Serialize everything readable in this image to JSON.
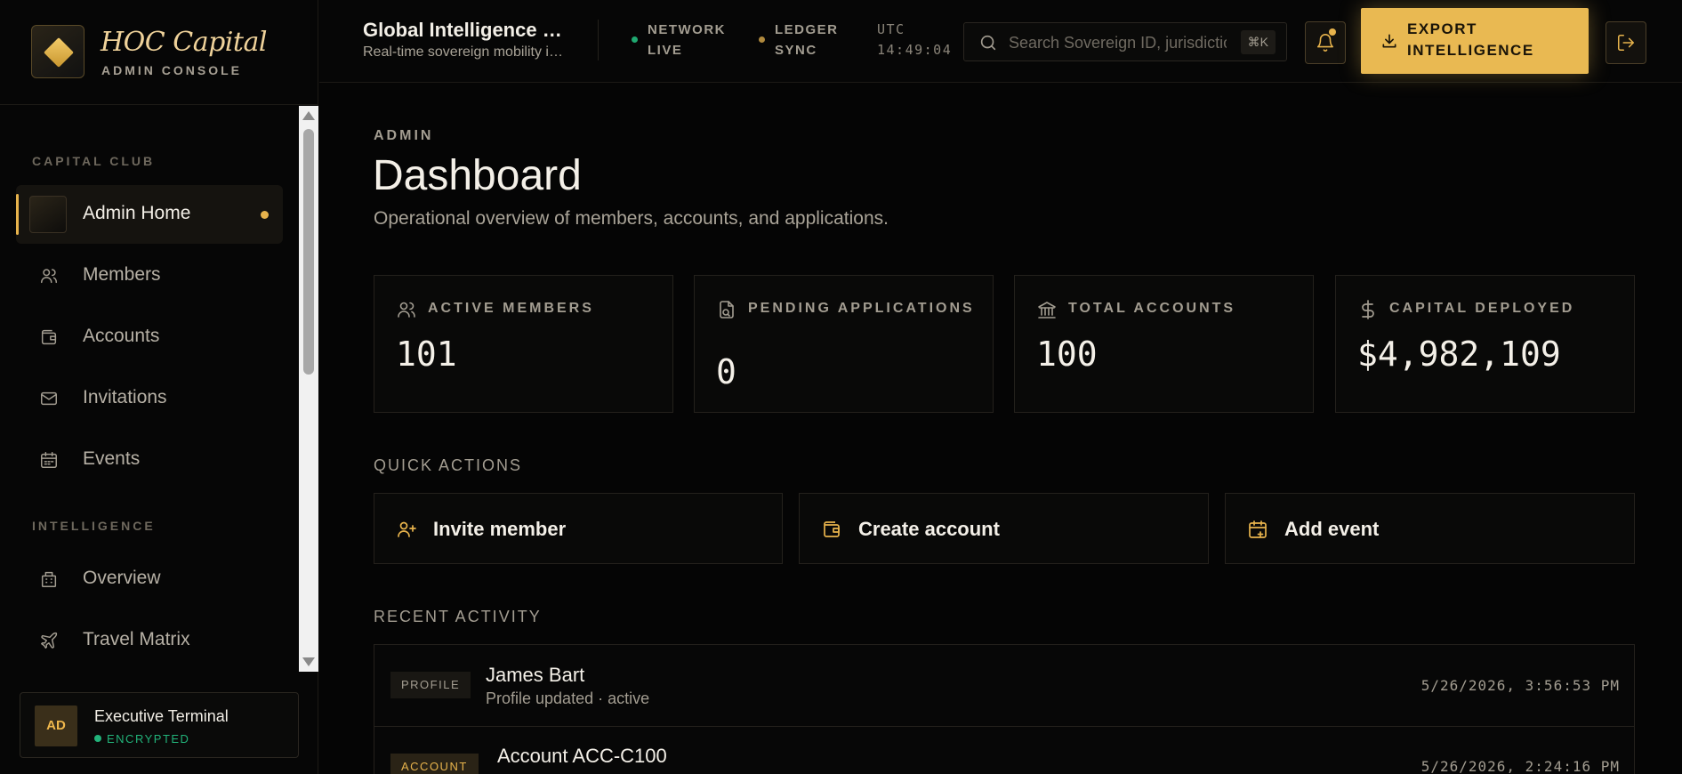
{
  "brand": {
    "name": "HOC Capital",
    "subtitle": "ADMIN CONSOLE"
  },
  "sidebar": {
    "sections": [
      {
        "title": "CAPITAL CLUB"
      },
      {
        "title": "INTELLIGENCE"
      }
    ],
    "items": [
      {
        "label": "Admin Home",
        "icon": "home-tile-icon",
        "active": true
      },
      {
        "label": "Members",
        "icon": "users-icon"
      },
      {
        "label": "Accounts",
        "icon": "wallet-icon"
      },
      {
        "label": "Invitations",
        "icon": "mail-icon"
      },
      {
        "label": "Events",
        "icon": "calendar-icon"
      },
      {
        "label": "Overview",
        "icon": "building-icon"
      },
      {
        "label": "Travel Matrix",
        "icon": "plane-icon"
      }
    ],
    "terminal": {
      "initials": "AD",
      "name": "Executive Terminal",
      "status": "ENCRYPTED"
    }
  },
  "topbar": {
    "title": "Global Intelligence Dashboard",
    "subtitle": "Real-time sovereign mobility intelligence",
    "network": {
      "line1": "NETWORK",
      "line2": "LIVE",
      "color": "#1fa870"
    },
    "ledger": {
      "line1": "LEDGER",
      "line2": "SYNC",
      "color": "#b08a3e"
    },
    "utc": {
      "label": "UTC",
      "time": "14:49:04"
    },
    "search": {
      "placeholder": "Search Sovereign ID, jurisdiction...",
      "shortcut": "⌘K"
    },
    "export_label": "EXPORT INTELLIGENCE"
  },
  "main": {
    "eyebrow": "ADMIN",
    "title": "Dashboard",
    "lead": "Operational overview of members, accounts, and applications.",
    "stats": [
      {
        "label": "ACTIVE MEMBERS",
        "value": "101",
        "icon": "users-icon"
      },
      {
        "label": "PENDING APPLICATIONS",
        "value": "0",
        "icon": "document-search-icon"
      },
      {
        "label": "TOTAL ACCOUNTS",
        "value": "100",
        "icon": "bank-icon"
      },
      {
        "label": "CAPITAL DEPLOYED",
        "value": "$4,982,109",
        "icon": "dollar-icon"
      }
    ],
    "quick_actions_title": "QUICK ACTIONS",
    "quick_actions": [
      {
        "label": "Invite member",
        "icon": "user-plus-icon"
      },
      {
        "label": "Create account",
        "icon": "wallet-icon"
      },
      {
        "label": "Add event",
        "icon": "calendar-plus-icon"
      }
    ],
    "recent_activity_title": "RECENT ACTIVITY",
    "activity": [
      {
        "tag": "PROFILE",
        "name": "James Bart",
        "desc": "Profile updated · active",
        "time": "5/26/2026, 3:56:53 PM"
      },
      {
        "tag": "ACCOUNT",
        "name": "Account ACC-C100",
        "desc": "",
        "time": "5/26/2026, 2:24:16 PM"
      }
    ]
  },
  "colors": {
    "accent": "#e9b952",
    "background": "#050505",
    "success": "#22b37a"
  }
}
